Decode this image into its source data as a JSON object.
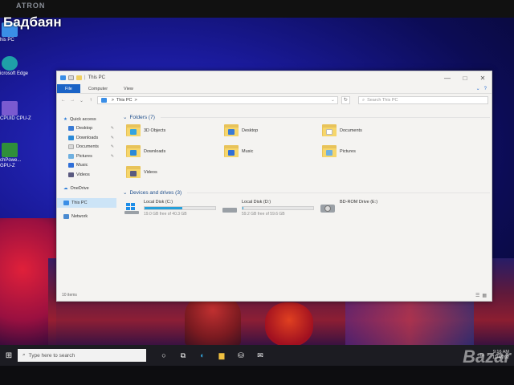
{
  "overlay": {
    "logo_text": "Бадбаян"
  },
  "monitor": {
    "brand": "ATRON"
  },
  "desktop_icons": [
    {
      "label": "his PC",
      "color": "#3a8ee6"
    },
    {
      "label": "icrosoft Edge",
      "color": "#1fa0a8"
    },
    {
      "label": "CPUID CPU-Z",
      "color": "#7a5ad0"
    },
    {
      "label": "chPowe... GPU-Z",
      "color": "#2f8f3a"
    }
  ],
  "window": {
    "title": "This PC",
    "ribbon_tabs": [
      "File",
      "Computer",
      "View"
    ],
    "controls": {
      "minimize": "—",
      "maximize": "□",
      "close": "✕"
    },
    "address": {
      "crumbs": [
        "This PC"
      ],
      "separator": ">"
    },
    "search_placeholder": "Search This PC",
    "nav": {
      "quick_access": "Quick access",
      "pinned": [
        "Desktop",
        "Downloads",
        "Documents",
        "Pictures"
      ],
      "unpinned": [
        "Music",
        "Videos"
      ],
      "onedrive": "OneDrive",
      "this_pc": "This PC",
      "network": "Network"
    },
    "folders_header": "Folders (7)",
    "folders": [
      {
        "name": "3D Objects",
        "emblem": "#33a4e0"
      },
      {
        "name": "Desktop",
        "emblem": "#3a7bd5"
      },
      {
        "name": "Documents",
        "emblem": "#ffffff"
      },
      {
        "name": "Downloads",
        "emblem": "#2a8ad8"
      },
      {
        "name": "Music",
        "emblem": "#2f6fd8"
      },
      {
        "name": "Pictures",
        "emblem": "#6fb0e0"
      },
      {
        "name": "Videos",
        "emblem": "#5a5a80"
      }
    ],
    "drives_header": "Devices and drives (3)",
    "drives": [
      {
        "name": "Local Disk (C:)",
        "free": "19.0 GB free of 40.3 GB",
        "used_fraction": 0.53
      },
      {
        "name": "Local Disk (D:)",
        "free": "59.2 GB free of 59.6 GB",
        "used_fraction": 0.01
      },
      {
        "name": "BD-ROM Drive (E:)",
        "free": "",
        "used_fraction": null
      }
    ],
    "status": "10 items"
  },
  "taskbar": {
    "search_placeholder": "Type here to search",
    "time": "9:16 AM",
    "date": "11/4/202"
  },
  "watermark": "Bazar"
}
